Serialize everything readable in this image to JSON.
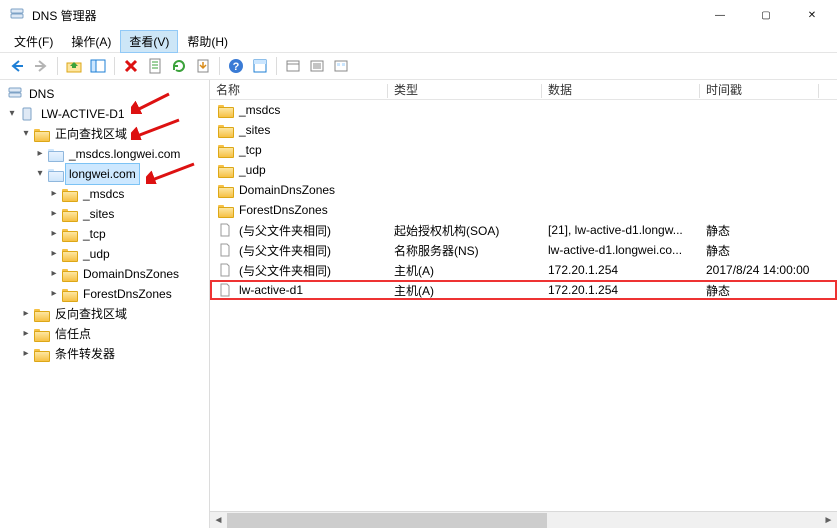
{
  "window": {
    "title": "DNS 管理器"
  },
  "menu": {
    "file": "文件(F)",
    "action": "操作(A)",
    "view": "查看(V)",
    "help": "帮助(H)"
  },
  "tree": {
    "root": "DNS",
    "server": "LW-ACTIVE-D1",
    "fwd_zone_label": "正向查找区域",
    "zone_msdcs": "_msdcs.longwei.com",
    "zone_main": "longwei.com",
    "sub": {
      "msdcs": "_msdcs",
      "sites": "_sites",
      "tcp": "_tcp",
      "udp": "_udp",
      "ddz": "DomainDnsZones",
      "fdz": "ForestDnsZones"
    },
    "rev_zone_label": "反向查找区域",
    "trust_points": "信任点",
    "conditional_fwd": "条件转发器"
  },
  "columns": {
    "name": "名称",
    "type": "类型",
    "data": "数据",
    "timestamp": "时间戳"
  },
  "records": [
    {
      "name": "_msdcs",
      "type": "",
      "data": "",
      "ts": "",
      "icon": "folder"
    },
    {
      "name": "_sites",
      "type": "",
      "data": "",
      "ts": "",
      "icon": "folder"
    },
    {
      "name": "_tcp",
      "type": "",
      "data": "",
      "ts": "",
      "icon": "folder"
    },
    {
      "name": "_udp",
      "type": "",
      "data": "",
      "ts": "",
      "icon": "folder"
    },
    {
      "name": "DomainDnsZones",
      "type": "",
      "data": "",
      "ts": "",
      "icon": "folder"
    },
    {
      "name": "ForestDnsZones",
      "type": "",
      "data": "",
      "ts": "",
      "icon": "folder"
    },
    {
      "name": "(与父文件夹相同)",
      "type": "起始授权机构(SOA)",
      "data": "[21], lw-active-d1.longw...",
      "ts": "静态",
      "icon": "file"
    },
    {
      "name": "(与父文件夹相同)",
      "type": "名称服务器(NS)",
      "data": "lw-active-d1.longwei.co...",
      "ts": "静态",
      "icon": "file"
    },
    {
      "name": "(与父文件夹相同)",
      "type": "主机(A)",
      "data": "172.20.1.254",
      "ts": "2017/8/24 14:00:00",
      "icon": "file"
    },
    {
      "name": "lw-active-d1",
      "type": "主机(A)",
      "data": "172.20.1.254",
      "ts": "静态",
      "icon": "file",
      "highlight": true
    }
  ]
}
